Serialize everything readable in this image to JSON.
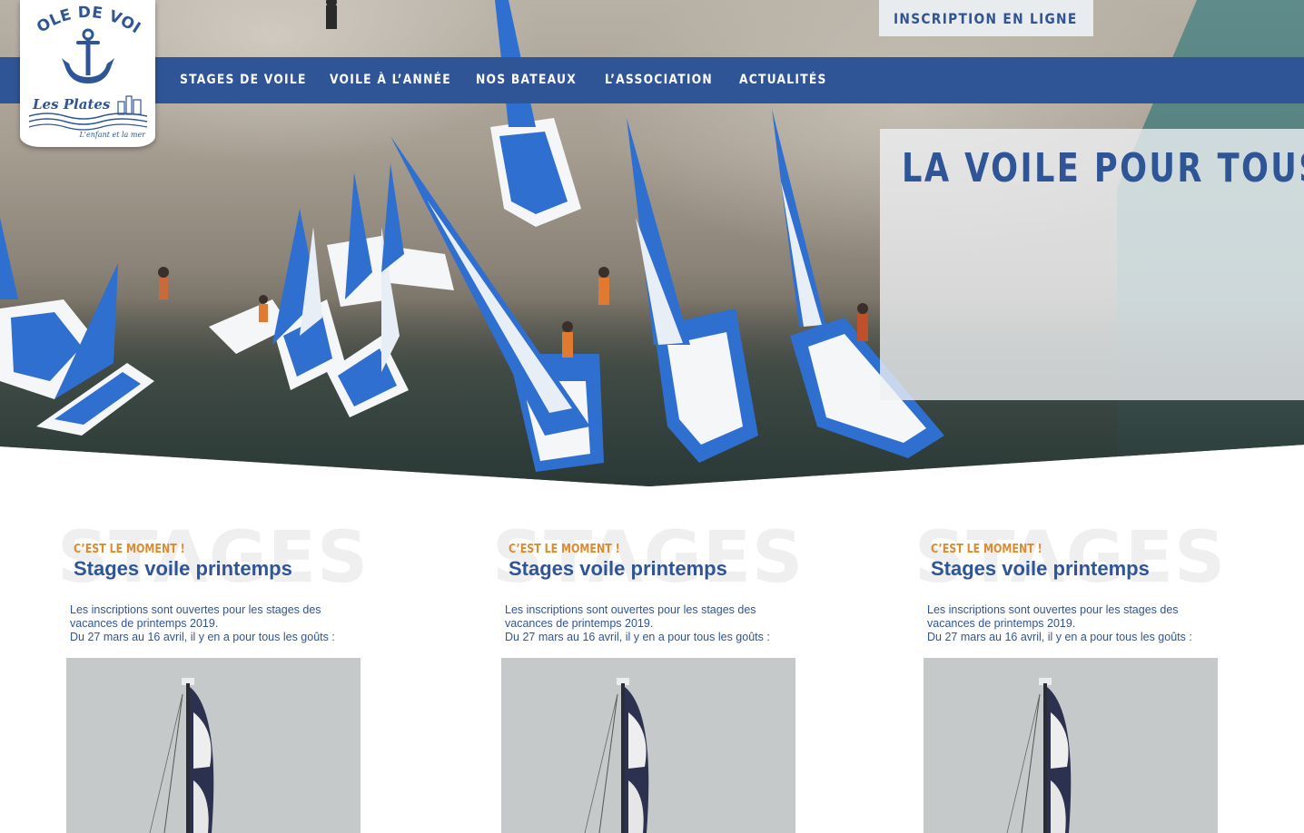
{
  "header": {
    "logo": {
      "top_text": "ÉCOLE DE VOILE",
      "name": "Les Plates",
      "tagline": "L'enfant et la mer"
    },
    "inscription_label": "INSCRIPTION EN LIGNE",
    "nav": [
      {
        "label": "STAGES DE VOILE"
      },
      {
        "label": "VOILE À L’ANNÉE"
      },
      {
        "label": "NOS BATEAUX"
      },
      {
        "label": "L’ASSOCIATION"
      },
      {
        "label": "ACTUALITÉS"
      }
    ]
  },
  "hero": {
    "title": "LA VOILE POUR TOUS"
  },
  "colors": {
    "brand_blue": "#2f5597",
    "accent_orange": "#e08a2e"
  },
  "cards": [
    {
      "ghost": "STAGES",
      "kicker": "C’EST LE MOMENT !",
      "title": "Stages voile printemps",
      "lines": [
        "Les inscriptions sont ouvertes pour les stages des",
        "vacances de printemps 2019.",
        "Du 27 mars au 16 avril, il y en a pour tous les goûts :"
      ]
    },
    {
      "ghost": "STAGES",
      "kicker": "C’EST LE MOMENT !",
      "title": "Stages voile printemps",
      "lines": [
        "Les inscriptions sont ouvertes pour les stages des",
        "vacances de printemps 2019.",
        "Du 27 mars au 16 avril, il y en a pour tous les goûts :"
      ]
    },
    {
      "ghost": "STAGES",
      "kicker": "C’EST LE MOMENT !",
      "title": "Stages voile printemps",
      "lines": [
        "Les inscriptions sont ouvertes pour les stages des",
        "vacances de printemps 2019.",
        "Du 27 mars au 16 avril, il y en a pour tous les goûts :"
      ]
    }
  ]
}
